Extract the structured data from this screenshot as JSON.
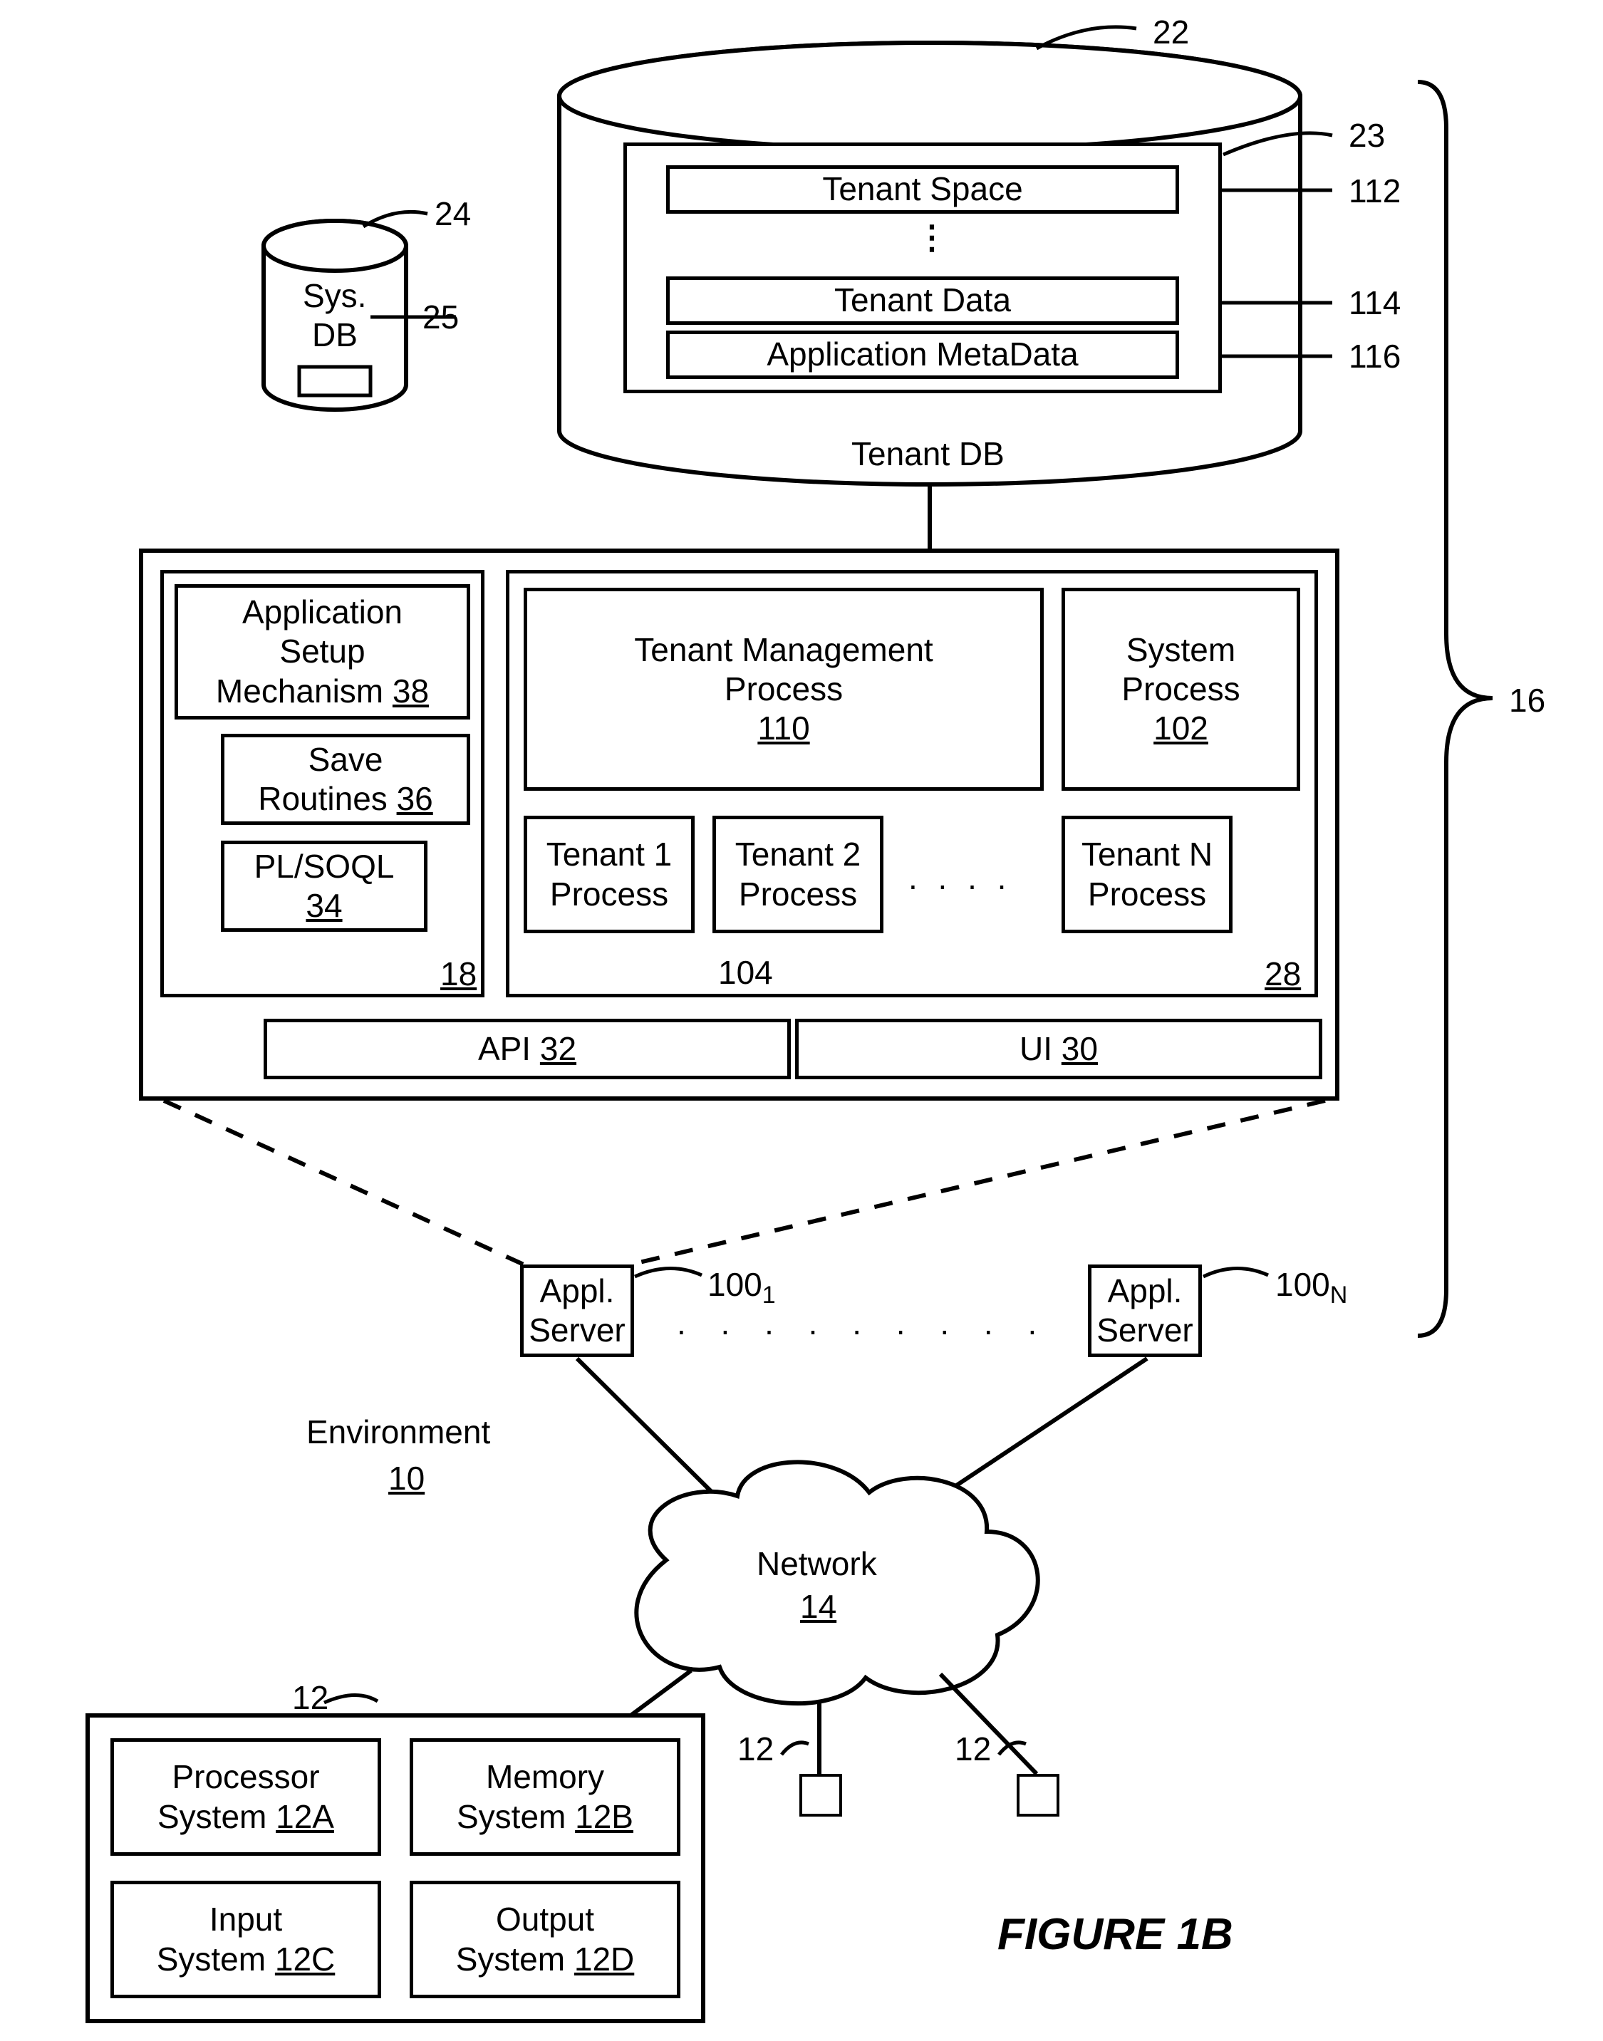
{
  "figure_title": "FIGURE 1B",
  "refs": {
    "sys_db": "24",
    "sys_db_inner": "25",
    "tenant_db": "22",
    "tenant_db_inner": "23",
    "tenant_space": "112",
    "tenant_data": "114",
    "app_metadata": "116",
    "system_ref": "16",
    "app_server_1": "100",
    "app_server_1_sub": "1",
    "app_server_n": "100",
    "app_server_n_sub": "N",
    "env": "10",
    "network": "14",
    "client": "12",
    "tenant_processes": "104"
  },
  "sys_db": {
    "line1": "Sys.",
    "line2": "DB"
  },
  "tenant_db": {
    "label": "Tenant DB",
    "tenant_space": "Tenant Space",
    "tenant_data": "Tenant Data",
    "app_metadata": "Application MetaData"
  },
  "server_block": {
    "app_setup_l1": "Application",
    "app_setup_l2": "Setup",
    "app_setup_l3": "Mechanism ",
    "app_setup_ref": "38",
    "save_l1": "Save",
    "save_l2": "Routines ",
    "save_ref": "36",
    "plsoql_l1": "PL/SOQL",
    "plsoql_ref": "34",
    "left_ref": "18",
    "tmp_l1": "Tenant Management",
    "tmp_l2": "Process",
    "tmp_ref": "110",
    "sysproc_l1": "System",
    "sysproc_l2": "Process",
    "sysproc_ref": "102",
    "t1_l1": "Tenant 1",
    "t1_l2": "Process",
    "t2_l1": "Tenant 2",
    "t2_l2": "Process",
    "tn_l1": "Tenant N",
    "tn_l2": "Process",
    "right_ref": "28",
    "api": "API ",
    "api_ref": "32",
    "ui": "UI ",
    "ui_ref": "30"
  },
  "appl_server": {
    "l1": "Appl.",
    "l2": "Server"
  },
  "environment": "Environment",
  "network": "Network",
  "client_block": {
    "proc_l1": "Processor",
    "proc_l2": "System ",
    "proc_ref": "12A",
    "mem_l1": "Memory",
    "mem_l2": "System ",
    "mem_ref": "12B",
    "in_l1": "Input",
    "in_l2": "System ",
    "in_ref": "12C",
    "out_l1": "Output",
    "out_l2": "System ",
    "out_ref": "12D"
  }
}
